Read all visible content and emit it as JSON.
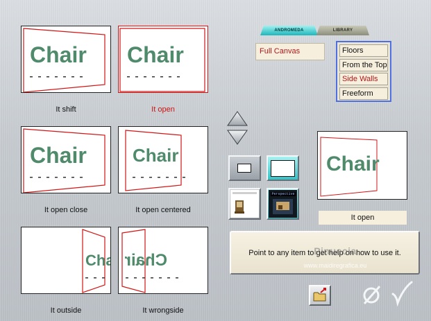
{
  "presets": [
    {
      "caption": "It shift",
      "selected": false
    },
    {
      "caption": "It open",
      "selected": true
    },
    {
      "caption": "It open close",
      "selected": false
    },
    {
      "caption": "It open centered",
      "selected": false
    },
    {
      "caption": "It outside",
      "selected": false
    },
    {
      "caption": "It wrongside",
      "selected": false
    }
  ],
  "thumbnail_word": "Chair",
  "tabs": {
    "active": "ANDROMEDA",
    "inactive": "LIBRARY"
  },
  "canvas_menu": {
    "selected_label": "Full Canvas",
    "options": [
      {
        "label": "Floors",
        "selected": false
      },
      {
        "label": "From the Top",
        "selected": false
      },
      {
        "label": "Side Walls",
        "selected": true
      },
      {
        "label": "Freeform",
        "selected": false
      }
    ]
  },
  "perspective_button_label": "Perspective",
  "preview_label": "It open",
  "help_text": "Point to any item to get help on how to use it.",
  "watermark": {
    "title": "Pinuccia",
    "url": "www.maidiregrafica.eu"
  },
  "icons": {
    "up": "arrow-up-icon",
    "down": "arrow-down-icon",
    "folder": "folder-open-icon",
    "cancel": "cancel-icon",
    "ok": "checkmark-icon"
  },
  "colors": {
    "selected_text": "#d21414",
    "active_tab": "#1fb7bb",
    "submenu_border": "#4f6fe0",
    "chair_text": "#4f8a6a"
  }
}
